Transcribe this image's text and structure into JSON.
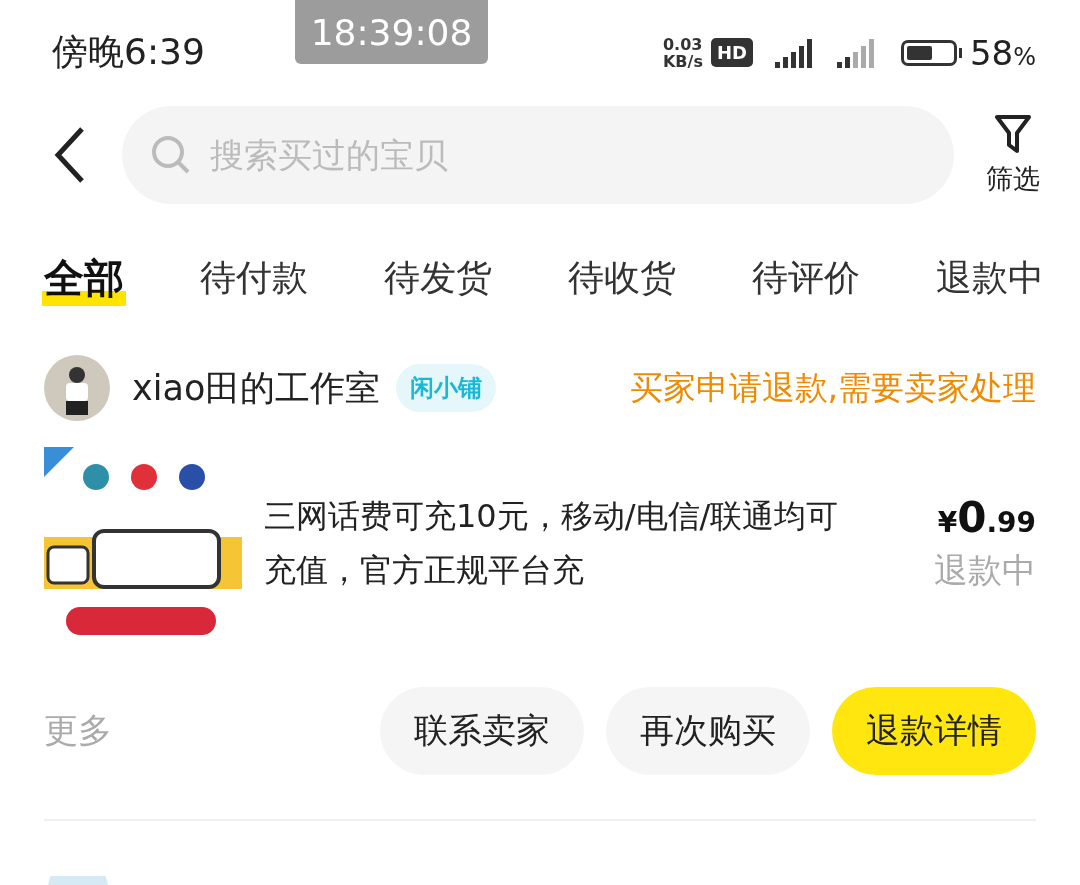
{
  "status_bar": {
    "time": "傍晚6:39",
    "speed_value": "0.03",
    "speed_unit": "KB/s",
    "hd_badge": "HD",
    "battery_percent": "58",
    "percent_sign": "%"
  },
  "recorder_overlay": {
    "time": "18:39:08"
  },
  "search": {
    "placeholder": "搜索买过的宝贝",
    "filter_label": "筛选"
  },
  "tabs": [
    {
      "label": "全部",
      "selected": true
    },
    {
      "label": "待付款",
      "selected": false
    },
    {
      "label": "待发货",
      "selected": false
    },
    {
      "label": "待收货",
      "selected": false
    },
    {
      "label": "待评价",
      "selected": false
    },
    {
      "label": "退款中",
      "selected": false
    }
  ],
  "orders": [
    {
      "shop_name": "xiao田的工作室",
      "shop_badge": "闲小铺",
      "status": "买家申请退款,需要卖家处理",
      "product": {
        "kind": "picture",
        "title": "三网话费可充10元，移动/电信/联通均可充值，官方正规平台充",
        "currency": "¥",
        "price_int": "0",
        "price_dec": ".99",
        "state": "退款中"
      },
      "more": "更多",
      "actions": [
        {
          "label": "联系卖家",
          "primary": false
        },
        {
          "label": "再次购买",
          "primary": false
        },
        {
          "label": "退款详情",
          "primary": true
        }
      ]
    }
  ]
}
